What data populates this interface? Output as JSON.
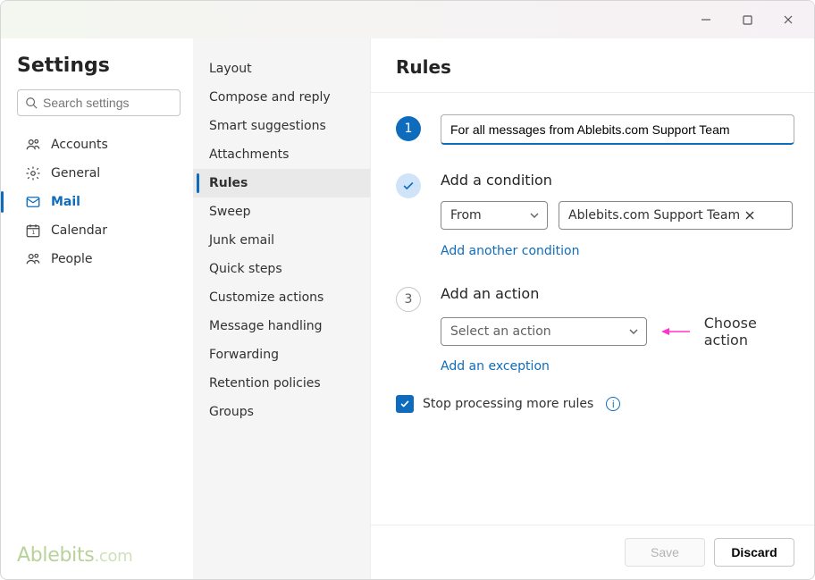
{
  "titlebar": {
    "minimize": "minimize",
    "maximize": "maximize",
    "close": "close"
  },
  "sidebar": {
    "title": "Settings",
    "search_placeholder": "Search settings",
    "items": [
      {
        "icon": "accounts",
        "label": "Accounts"
      },
      {
        "icon": "general",
        "label": "General"
      },
      {
        "icon": "mail",
        "label": "Mail",
        "active": true
      },
      {
        "icon": "calendar",
        "label": "Calendar"
      },
      {
        "icon": "people",
        "label": "People"
      }
    ],
    "watermark": {
      "brand": "Ablebits",
      "suffix": ".com"
    }
  },
  "subnav": {
    "items": [
      "Layout",
      "Compose and reply",
      "Smart suggestions",
      "Attachments",
      "Rules",
      "Sweep",
      "Junk email",
      "Quick steps",
      "Customize actions",
      "Message handling",
      "Forwarding",
      "Retention policies",
      "Groups"
    ],
    "active_index": 4
  },
  "content": {
    "heading": "Rules",
    "step1": {
      "badge": "1",
      "rule_name": "For all messages from Ablebits.com Support Team"
    },
    "step2": {
      "title": "Add a condition",
      "condition_field": "From",
      "condition_value": "Ablebits.com Support Team",
      "add_another": "Add another condition"
    },
    "step3": {
      "badge": "3",
      "title": "Add an action",
      "action_placeholder": "Select an action",
      "add_exception": "Add an exception",
      "annotation": "Choose action"
    },
    "stop_processing": {
      "checked": true,
      "label": "Stop processing more rules"
    },
    "footer": {
      "save": "Save",
      "discard": "Discard"
    }
  }
}
